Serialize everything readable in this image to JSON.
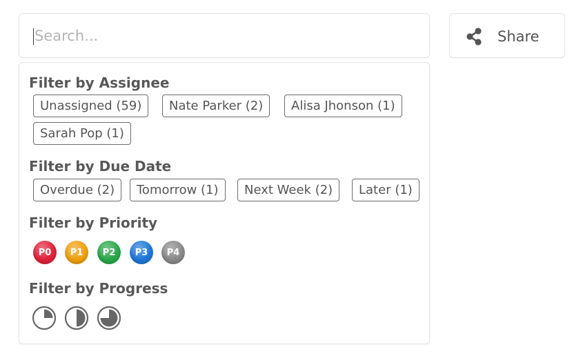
{
  "search": {
    "placeholder": "Search..."
  },
  "share": {
    "label": "Share",
    "icon": "share-icon"
  },
  "filters": {
    "assignee": {
      "title": "Filter by Assignee",
      "chips": [
        "Unassigned (59)",
        "Nate Parker (2)",
        "Alisa Jhonson (1)",
        "Sarah Pop (1)"
      ]
    },
    "due_date": {
      "title": "Filter by Due Date",
      "chips": [
        "Overdue (2)",
        "Tomorrow (1)",
        "Next Week (2)",
        "Later (1)"
      ]
    },
    "priority": {
      "title": "Filter by Priority",
      "levels": [
        {
          "label": "P0",
          "color": "#e0223a"
        },
        {
          "label": "P1",
          "color": "#f0a010"
        },
        {
          "label": "P2",
          "color": "#2aa84a"
        },
        {
          "label": "P3",
          "color": "#1f78d8"
        },
        {
          "label": "P4",
          "color": "#8a8a8a"
        }
      ]
    },
    "progress": {
      "title": "Filter by Progress",
      "levels": [
        0.25,
        0.5,
        0.75
      ]
    }
  },
  "colors": {
    "text": "#555555",
    "border": "#e3e3e3",
    "chip_border": "#6b6b6b"
  }
}
